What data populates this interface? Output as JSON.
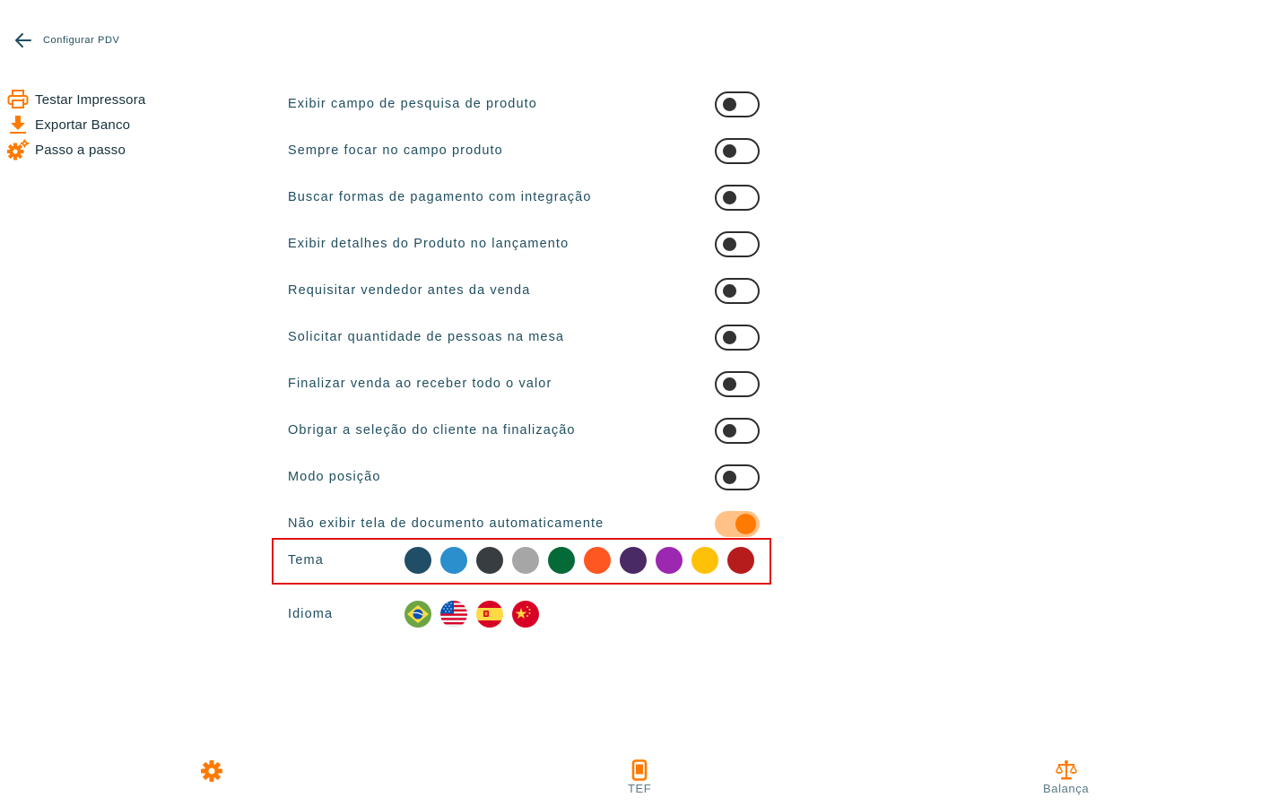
{
  "header": {
    "title": "Configurar PDV"
  },
  "side_menu": {
    "items": [
      {
        "label": "Testar Impressora",
        "icon": "printer-icon"
      },
      {
        "label": "Exportar Banco",
        "icon": "download-icon"
      },
      {
        "label": "Passo a passo",
        "icon": "gears-icon"
      }
    ]
  },
  "settings": [
    {
      "label": "Exibir campo de pesquisa de produto",
      "enabled": false
    },
    {
      "label": "Sempre focar no campo produto",
      "enabled": false
    },
    {
      "label": "Buscar formas de pagamento com integração",
      "enabled": false
    },
    {
      "label": "Exibir detalhes do Produto no lançamento",
      "enabled": false
    },
    {
      "label": "Requisitar vendedor antes da venda",
      "enabled": false
    },
    {
      "label": "Solicitar quantidade de pessoas na mesa",
      "enabled": false
    },
    {
      "label": "Finalizar venda ao receber todo o valor",
      "enabled": false
    },
    {
      "label": "Obrigar a seleção do cliente na finalização",
      "enabled": false
    },
    {
      "label": "Modo posição",
      "enabled": false
    },
    {
      "label": "Não exibir tela de documento automaticamente",
      "enabled": true
    }
  ],
  "theme": {
    "label": "Tema",
    "colors": [
      "#1f4e66",
      "#2a8fcc",
      "#373d41",
      "#a6a6a6",
      "#046a38",
      "#ff5722",
      "#4a2a64",
      "#9c27b0",
      "#ffc107",
      "#b71c1c"
    ]
  },
  "language": {
    "label": "Idioma",
    "flags": [
      "brazil-flag-icon",
      "usa-flag-icon",
      "spain-flag-icon",
      "china-flag-icon"
    ]
  },
  "bottom_nav": {
    "settings_icon": "gear-icon",
    "tef_label": "TEF",
    "tef_icon": "phone-icon",
    "balance_label": "Balança",
    "balance_icon": "scale-icon"
  },
  "colors": {
    "accent": "#ff7a00",
    "text": "#1f4e5f",
    "highlight_border": "#e01010"
  }
}
